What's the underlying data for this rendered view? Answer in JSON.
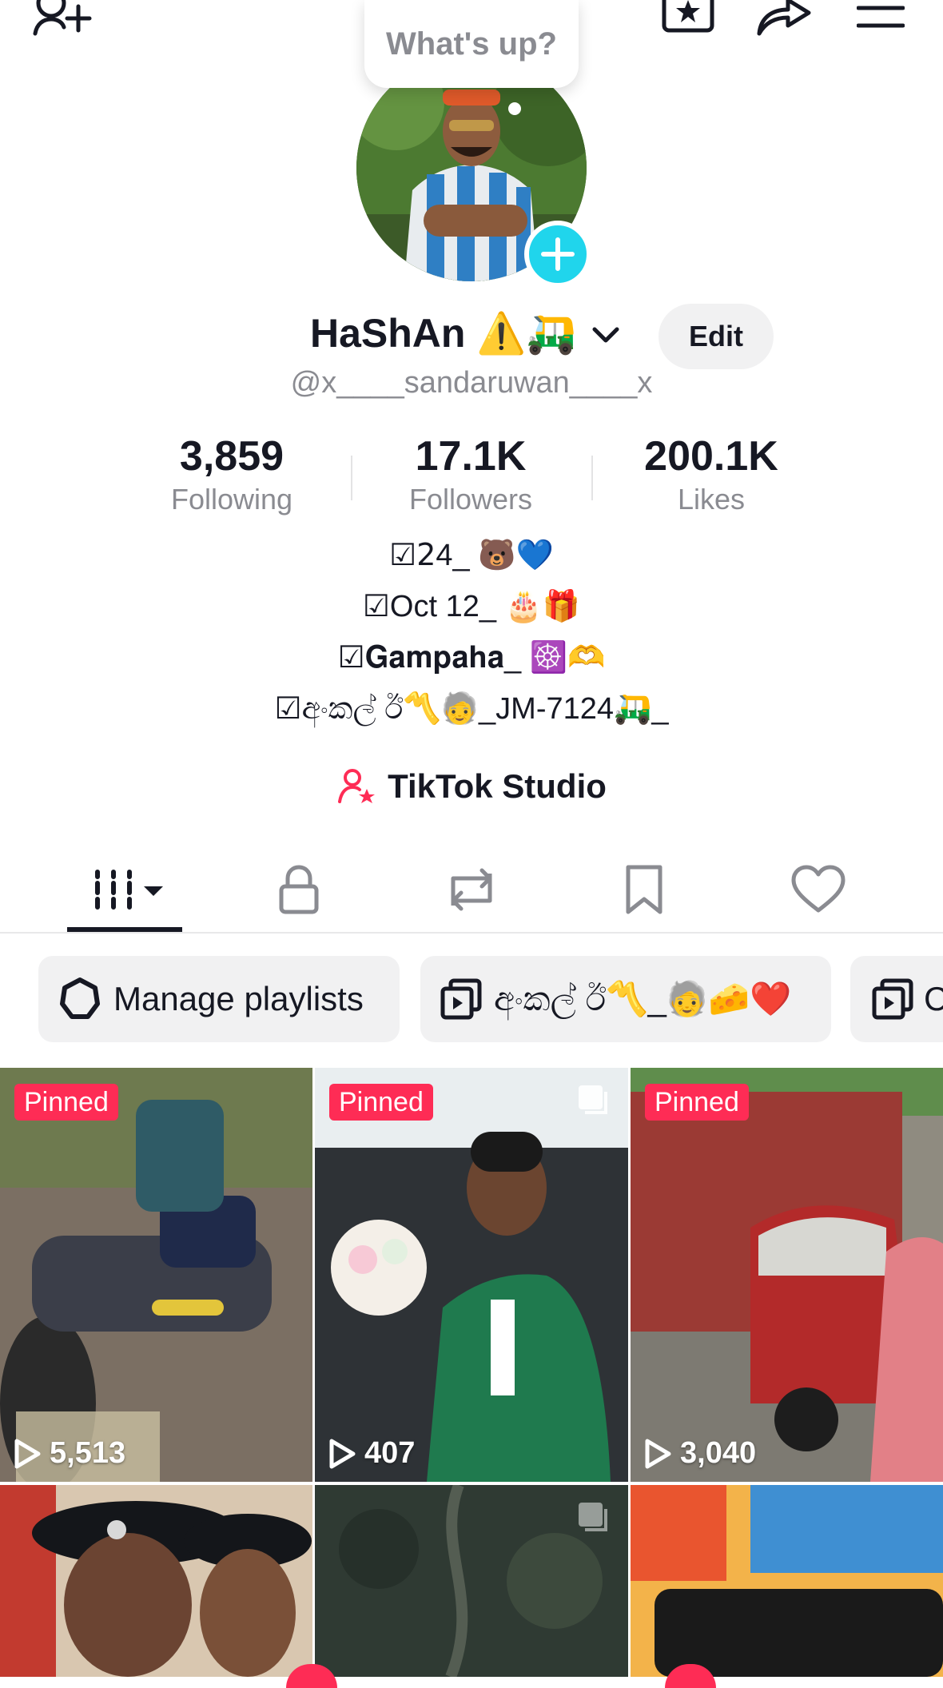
{
  "header": {
    "icons": [
      "add-friend-icon",
      "favorites-icon",
      "share-icon",
      "menu-icon"
    ],
    "bubble_text": "What's up?"
  },
  "profile": {
    "name": "HaShAn ⚠️🛺",
    "handle": "@x____sandaruwan____x",
    "edit_label": "Edit",
    "stats": [
      {
        "value": "3,859",
        "label": "Following"
      },
      {
        "value": "17.1K",
        "label": "Followers"
      },
      {
        "value": "200.1K",
        "label": "Likes"
      }
    ],
    "bio": [
      "☑𝟤4_ 🐻💙",
      "☑Oct 12_ 🎂🎁",
      "☑𝐆𝐚𝐦𝐩𝐚𝐡𝐚_ ☸️🫶",
      "☑අංකල් ඊ〽️🧓_JM-7124🛺_"
    ],
    "studio_label": "TikTok Studio"
  },
  "tabs": [
    "videos-tab",
    "private-tab",
    "reposts-tab",
    "favorites-tab",
    "liked-tab"
  ],
  "playlists": [
    {
      "label": "Manage playlists"
    },
    {
      "label": "අංකල් ඊ〽️_🧓🧀❤️"
    },
    {
      "label": "C"
    }
  ],
  "videos": [
    {
      "pinned": "Pinned",
      "views": "5,513"
    },
    {
      "pinned": "Pinned",
      "views": "407"
    },
    {
      "pinned": "Pinned",
      "views": "3,040"
    },
    {
      "pinned": "",
      "views": ""
    },
    {
      "pinned": "",
      "views": ""
    },
    {
      "pinned": "",
      "views": ""
    }
  ],
  "colors": {
    "accent": "#fe2c55",
    "cyan": "#20d5ec",
    "text": "#161823",
    "muted": "#8a8b91"
  }
}
